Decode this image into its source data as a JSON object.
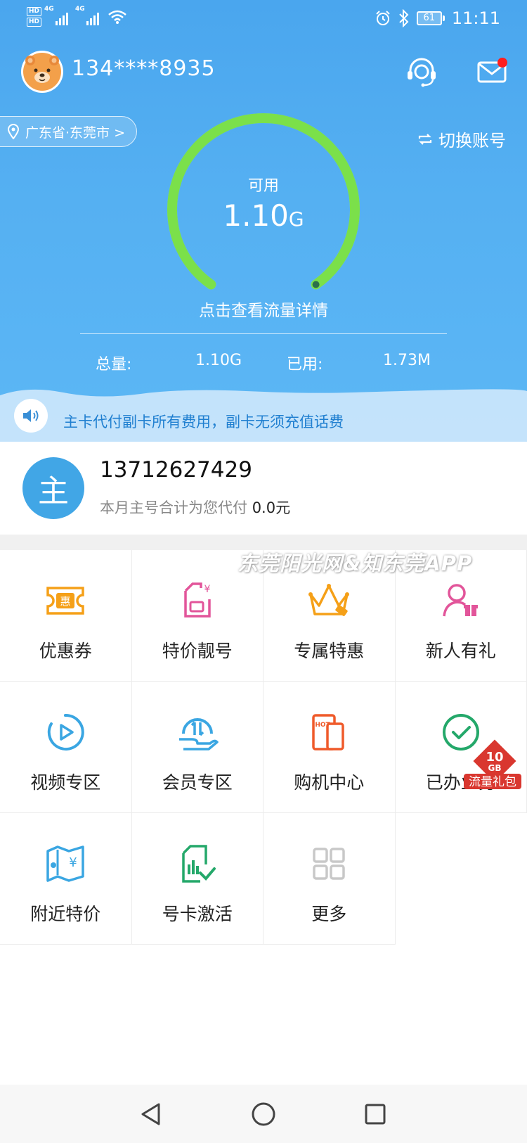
{
  "status_bar": {
    "hd1": "HD",
    "hd2": "HD",
    "net1": "4G",
    "net2": "4G",
    "battery": "61",
    "time": "11:11"
  },
  "user": {
    "phone_masked": "134****8935",
    "location": "广东省·东莞市 >",
    "switch_account": "切换账号"
  },
  "usage": {
    "label": "可用",
    "value": "1.10",
    "unit": "G",
    "remaining_fraction": 1.0,
    "detail_link": "点击查看流量详情",
    "total_label": "总量:",
    "total_value": "1.10G",
    "used_label": "已用:",
    "used_value": "1.73M"
  },
  "notice": {
    "text": "主卡代付副卡所有费用，副卡无须充值话费"
  },
  "primary_card": {
    "badge": "主",
    "number": "13712627429",
    "pay_text": "本月主号合计为您代付",
    "pay_amount": "0.0元"
  },
  "watermark": "东莞阳光网&知东莞APP",
  "grid": [
    {
      "label": "优惠券",
      "icon": "coupon-icon"
    },
    {
      "label": "特价靓号",
      "icon": "sim-price-icon"
    },
    {
      "label": "专属特惠",
      "icon": "crown-icon"
    },
    {
      "label": "新人有礼",
      "icon": "new-user-gift-icon"
    },
    {
      "label": "视频专区",
      "icon": "video-play-icon"
    },
    {
      "label": "会员专区",
      "icon": "member-hand-icon"
    },
    {
      "label": "购机中心",
      "icon": "phone-hot-icon"
    },
    {
      "label": "已办业务",
      "icon": "check-circle-icon"
    },
    {
      "label": "附近特价",
      "icon": "map-price-icon"
    },
    {
      "label": "号卡激活",
      "icon": "sim-activate-icon"
    },
    {
      "label": "更多",
      "icon": "more-grid-icon"
    }
  ],
  "gift_badge": {
    "amount": "10",
    "unit": "GB",
    "text": "流量礼包"
  },
  "colors": {
    "header_blue": "#4aa6ee",
    "gauge_green": "#7be04a",
    "notice_text": "#1f7fd0",
    "badge_blue": "#41a6e6",
    "orange": "#f5a018",
    "pink": "#e2559a",
    "cyan": "#3aa6e2",
    "red_orange": "#ef5a2a",
    "green": "#24a86a"
  }
}
